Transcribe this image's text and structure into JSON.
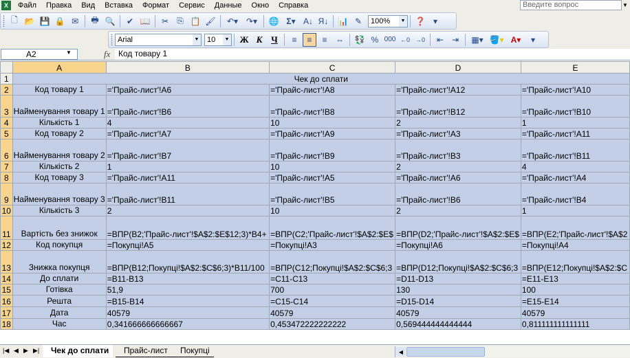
{
  "menu": {
    "items": [
      "Файл",
      "Правка",
      "Вид",
      "Вставка",
      "Формат",
      "Сервис",
      "Данные",
      "Окно",
      "Справка"
    ],
    "help_placeholder": "Введите вопрос"
  },
  "toolbar": {
    "zoom": "100%",
    "font_name": "Arial",
    "font_size": "10",
    "bold_label": "Ж",
    "italic_label": "К",
    "underline_label": "Ч",
    "sigma_label": "Σ",
    "percent_label": "%",
    "thousands_label": "000"
  },
  "formula_bar": {
    "cell_ref": "A2",
    "fx_label": "fx",
    "content": "Код товару 1"
  },
  "grid": {
    "columns": [
      "A",
      "B",
      "C",
      "D",
      "E"
    ],
    "title": "Чек до сплати",
    "rows": [
      {
        "n": "2",
        "a": "Код товару 1",
        "b": "='Прайс-лист'!A6",
        "c": "='Прайс-лист'!A8",
        "d": "='Прайс-лист'!A12",
        "e": "='Прайс-лист'!A10"
      },
      {
        "n": "3",
        "a": "Найменування товару 1",
        "b": "='Прайс-лист'!B6",
        "c": "='Прайс-лист'!B8",
        "d": "='Прайс-лист'!B12",
        "e": "='Прайс-лист'!B10"
      },
      {
        "n": "4",
        "a": "Кількість 1",
        "b": "4",
        "c": "10",
        "d": "2",
        "e": "1"
      },
      {
        "n": "5",
        "a": "Код товару 2",
        "b": "='Прайс-лист'!A7",
        "c": "='Прайс-лист'!A9",
        "d": "='Прайс-лист'!A3",
        "e": "='Прайс-лист'!A11"
      },
      {
        "n": "6",
        "a": "Найменування товару 2",
        "b": "='Прайс-лист'!B7",
        "c": "='Прайс-лист'!B9",
        "d": "='Прайс-лист'!B3",
        "e": "='Прайс-лист'!B11"
      },
      {
        "n": "7",
        "a": "Кількість 2",
        "b": "1",
        "c": "10",
        "d": "2",
        "e": "4"
      },
      {
        "n": "8",
        "a": "Код товару 3",
        "b": "='Прайс-лист'!A11",
        "c": "='Прайс-лист'!A5",
        "d": "='Прайс-лист'!A6",
        "e": "='Прайс-лист'!A4"
      },
      {
        "n": "9",
        "a": "Найменування товару 3",
        "b": "='Прайс-лист'!B11",
        "c": "='Прайс-лист'!B5",
        "d": "='Прайс-лист'!B6",
        "e": "='Прайс-лист'!B4"
      },
      {
        "n": "10",
        "a": "Кількість 3",
        "b": "2",
        "c": "10",
        "d": "2",
        "e": "1"
      },
      {
        "n": "11",
        "a": "Вартість без знижок",
        "b": "=ВПР(B2;'Прайс-лист'!$A$2:$E$12;3)*B4+",
        "c": "=ВПР(C2;'Прайс-лист'!$A$2:$E$",
        "d": "=ВПР(D2;'Прайс-лист'!$A$2:$E$",
        "e": "=ВПР(E2;'Прайс-лист'!$A$2"
      },
      {
        "n": "12",
        "a": "Код покупця",
        "b": "=Покупці!A5",
        "c": "=Покупці!A3",
        "d": "=Покупці!A6",
        "e": "=Покупці!A4"
      },
      {
        "n": "13",
        "a": "Знижка покупця",
        "b": "=ВПР(B12;Покупці!$A$2:$C$6;3)*B11/100",
        "c": "=ВПР(C12;Покупці!$A$2:$C$6;3",
        "d": "=ВПР(D12;Покупці!$A$2:$C$6;3",
        "e": "=ВПР(E12;Покупці!$A$2:$C"
      },
      {
        "n": "14",
        "a": "До сплати",
        "b": "=B11-B13",
        "c": "=C11-C13",
        "d": "=D11-D13",
        "e": "=E11-E13"
      },
      {
        "n": "15",
        "a": "Готівка",
        "b": "51,9",
        "c": "700",
        "d": "130",
        "e": "100"
      },
      {
        "n": "16",
        "a": "Решта",
        "b": "=B15-B14",
        "c": "=C15-C14",
        "d": "=D15-D14",
        "e": "=E15-E14"
      },
      {
        "n": "17",
        "a": "Дата",
        "b": "40579",
        "c": "40579",
        "d": "40579",
        "e": "40579"
      },
      {
        "n": "18",
        "a": "Час",
        "b": "0,341666666666667",
        "c": "0,453472222222222",
        "d": "0,569444444444444",
        "e": "0,811111111111111"
      }
    ]
  },
  "sheet_tabs": {
    "active": "Чек до сплати",
    "tabs": [
      "Чек до сплати",
      "Прайс-лист",
      "Покупці"
    ]
  }
}
